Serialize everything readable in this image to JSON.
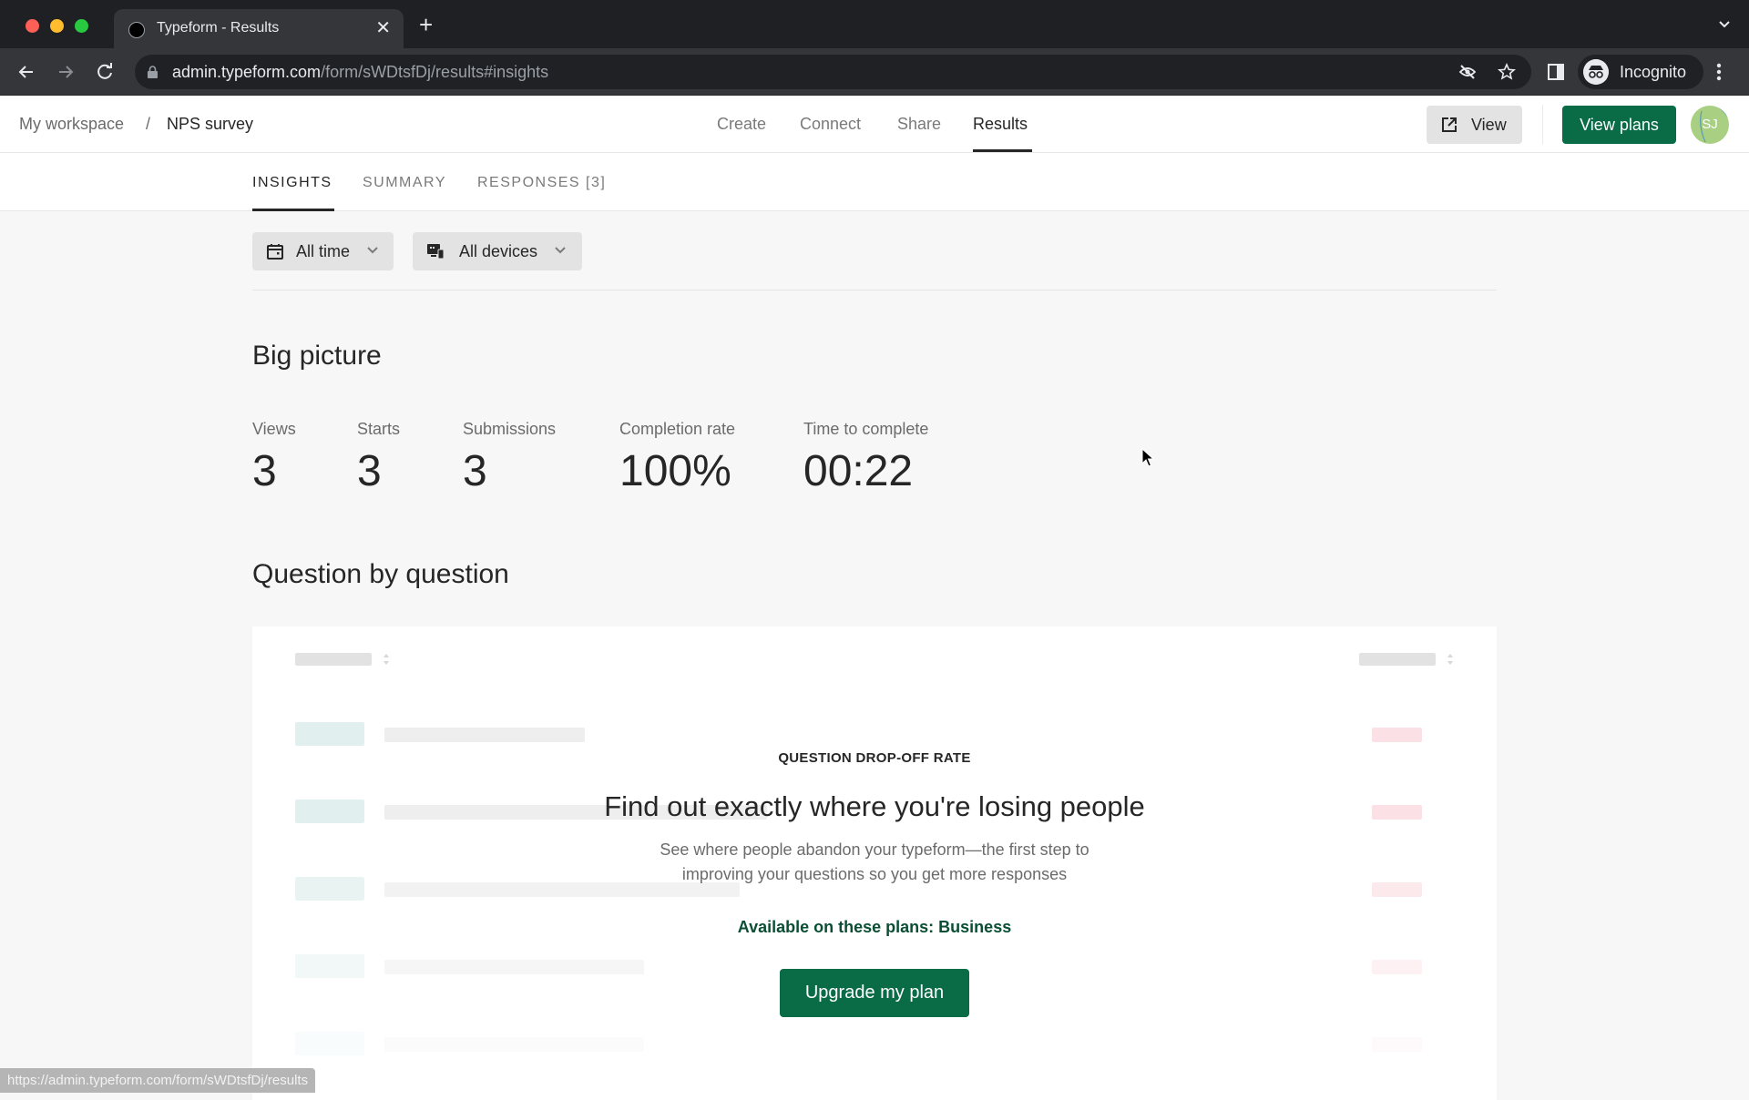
{
  "browser": {
    "tab_title": "Typeform - Results",
    "url_host": "admin.typeform.com",
    "url_path": "/form/sWDtsfDj/results#insights",
    "profile_label": "Incognito",
    "status_url": "https://admin.typeform.com/form/sWDtsfDj/results",
    "icons": {
      "back": "arrow-left-icon",
      "forward": "arrow-right-icon",
      "reload": "reload-icon",
      "lock": "lock-icon",
      "tracking": "eye-slash-icon",
      "bookmark": "star-icon",
      "side_panel": "side-panel-icon",
      "menu": "kebab-menu-icon",
      "new_tab": "plus-icon",
      "close_tab": "close-icon",
      "tab_list": "chevron-down-icon"
    }
  },
  "header": {
    "breadcrumb": {
      "workspace": "My workspace",
      "separator": "/",
      "form": "NPS survey"
    },
    "nav": [
      {
        "label": "Create",
        "active": false
      },
      {
        "label": "Connect",
        "active": false
      },
      {
        "label": "Share",
        "active": false
      },
      {
        "label": "Results",
        "active": true
      }
    ],
    "view_label": "View",
    "view_plans_label": "View plans",
    "avatar_initials": "SJ"
  },
  "subtabs": [
    {
      "label": "INSIGHTS",
      "active": true
    },
    {
      "label": "SUMMARY",
      "active": false
    },
    {
      "label": "RESPONSES [3]",
      "active": false
    }
  ],
  "filters": {
    "time": "All time",
    "devices": "All devices"
  },
  "big_picture": {
    "title": "Big picture",
    "metrics": [
      {
        "label": "Views",
        "value": "3"
      },
      {
        "label": "Starts",
        "value": "3"
      },
      {
        "label": "Submissions",
        "value": "3"
      },
      {
        "label": "Completion rate",
        "value": "100%"
      },
      {
        "label": "Time to complete",
        "value": "00:22"
      }
    ]
  },
  "question_by_question": {
    "title": "Question by question",
    "upsell": {
      "eyebrow": "QUESTION DROP-OFF RATE",
      "title": "Find out exactly where you're losing people",
      "description_line1": "See where people abandon your typeform—the first step to",
      "description_line2": "improving your questions so you get more responses",
      "plans": "Available on these plans: Business",
      "button_label": "Upgrade my plan"
    }
  },
  "colors": {
    "brand_green": "#0a6b47",
    "plans_text": "#0a4f35",
    "placeholder_teal": "#e1f0ee",
    "placeholder_pink": "#fbe1e6"
  }
}
